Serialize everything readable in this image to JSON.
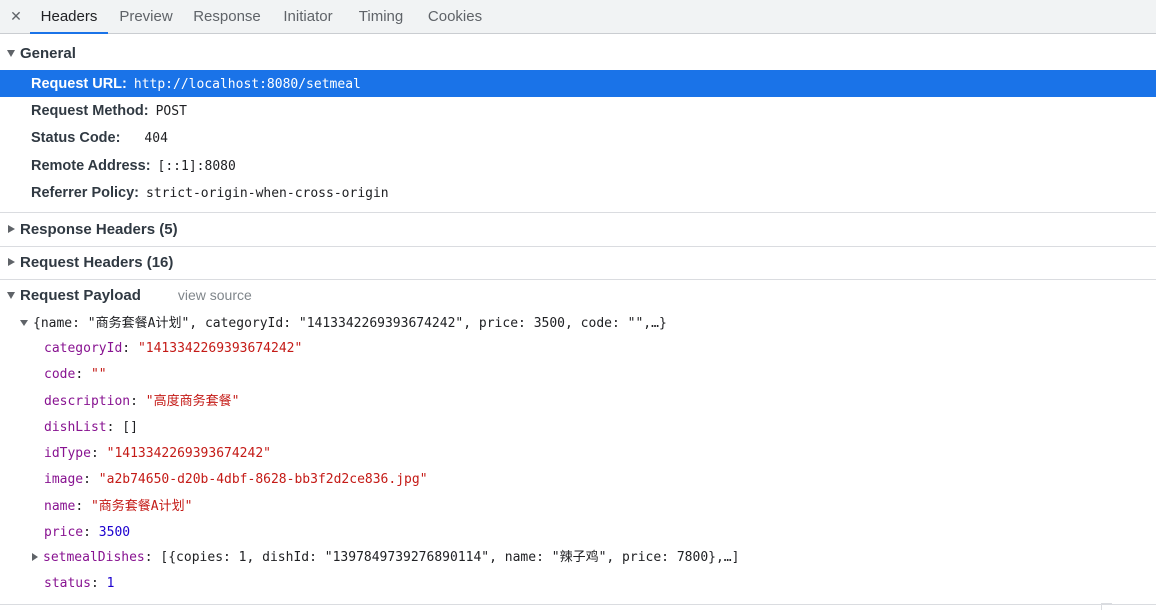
{
  "tabs": {
    "close_label": "✕",
    "items": [
      "Headers",
      "Preview",
      "Response",
      "Initiator",
      "Timing",
      "Cookies"
    ],
    "active": "Headers"
  },
  "general": {
    "title": "General",
    "rows": [
      {
        "key": "Request URL:",
        "value": "http://localhost:8080/setmeal",
        "selected": true
      },
      {
        "key": "Request Method:",
        "value": "POST"
      },
      {
        "key": "Status Code:",
        "value": "404"
      },
      {
        "key": "Remote Address:",
        "value": "[::1]:8080"
      },
      {
        "key": "Referrer Policy:",
        "value": "strict-origin-when-cross-origin"
      }
    ]
  },
  "response_headers": {
    "title": "Response Headers (5)"
  },
  "request_headers": {
    "title": "Request Headers (16)"
  },
  "payload": {
    "title": "Request Payload",
    "view_source": "view source",
    "summary": {
      "open": "{",
      "parts": [
        {
          "k": "name",
          "v": "\"商务套餐A计划\""
        },
        {
          "k": "categoryId",
          "v": "\"1413342269393674242\""
        },
        {
          "k": "price",
          "v": "3500"
        },
        {
          "k": "code",
          "v": "\"\""
        }
      ],
      "tail": ",…}"
    },
    "fields": [
      {
        "key": "categoryId",
        "value": "\"1413342269393674242\"",
        "type": "string"
      },
      {
        "key": "code",
        "value": "\"\"",
        "type": "string"
      },
      {
        "key": "description",
        "value": "\"高度商务套餐\"",
        "type": "string"
      },
      {
        "key": "dishList",
        "value": "[]",
        "type": "plain"
      },
      {
        "key": "idType",
        "value": "\"1413342269393674242\"",
        "type": "string"
      },
      {
        "key": "image",
        "value": "\"a2b74650-d20b-4dbf-8628-bb3f2d2ce836.jpg\"",
        "type": "string"
      },
      {
        "key": "name",
        "value": "\"商务套餐A计划\"",
        "type": "string"
      },
      {
        "key": "price",
        "value": "3500",
        "type": "number"
      },
      {
        "key": "setmealDishes",
        "value": "[{copies: 1, dishId: \"1397849739276890114\", name: \"辣子鸡\", price: 7800},…]",
        "type": "plain",
        "collapsed": true
      },
      {
        "key": "status",
        "value": "1",
        "type": "number"
      }
    ]
  },
  "colors": {
    "selected_row": "#1a73e8",
    "key": "#881391",
    "string": "#c41a16",
    "number": "#1c00cf",
    "active_tab_underline": "#1a73e8"
  }
}
